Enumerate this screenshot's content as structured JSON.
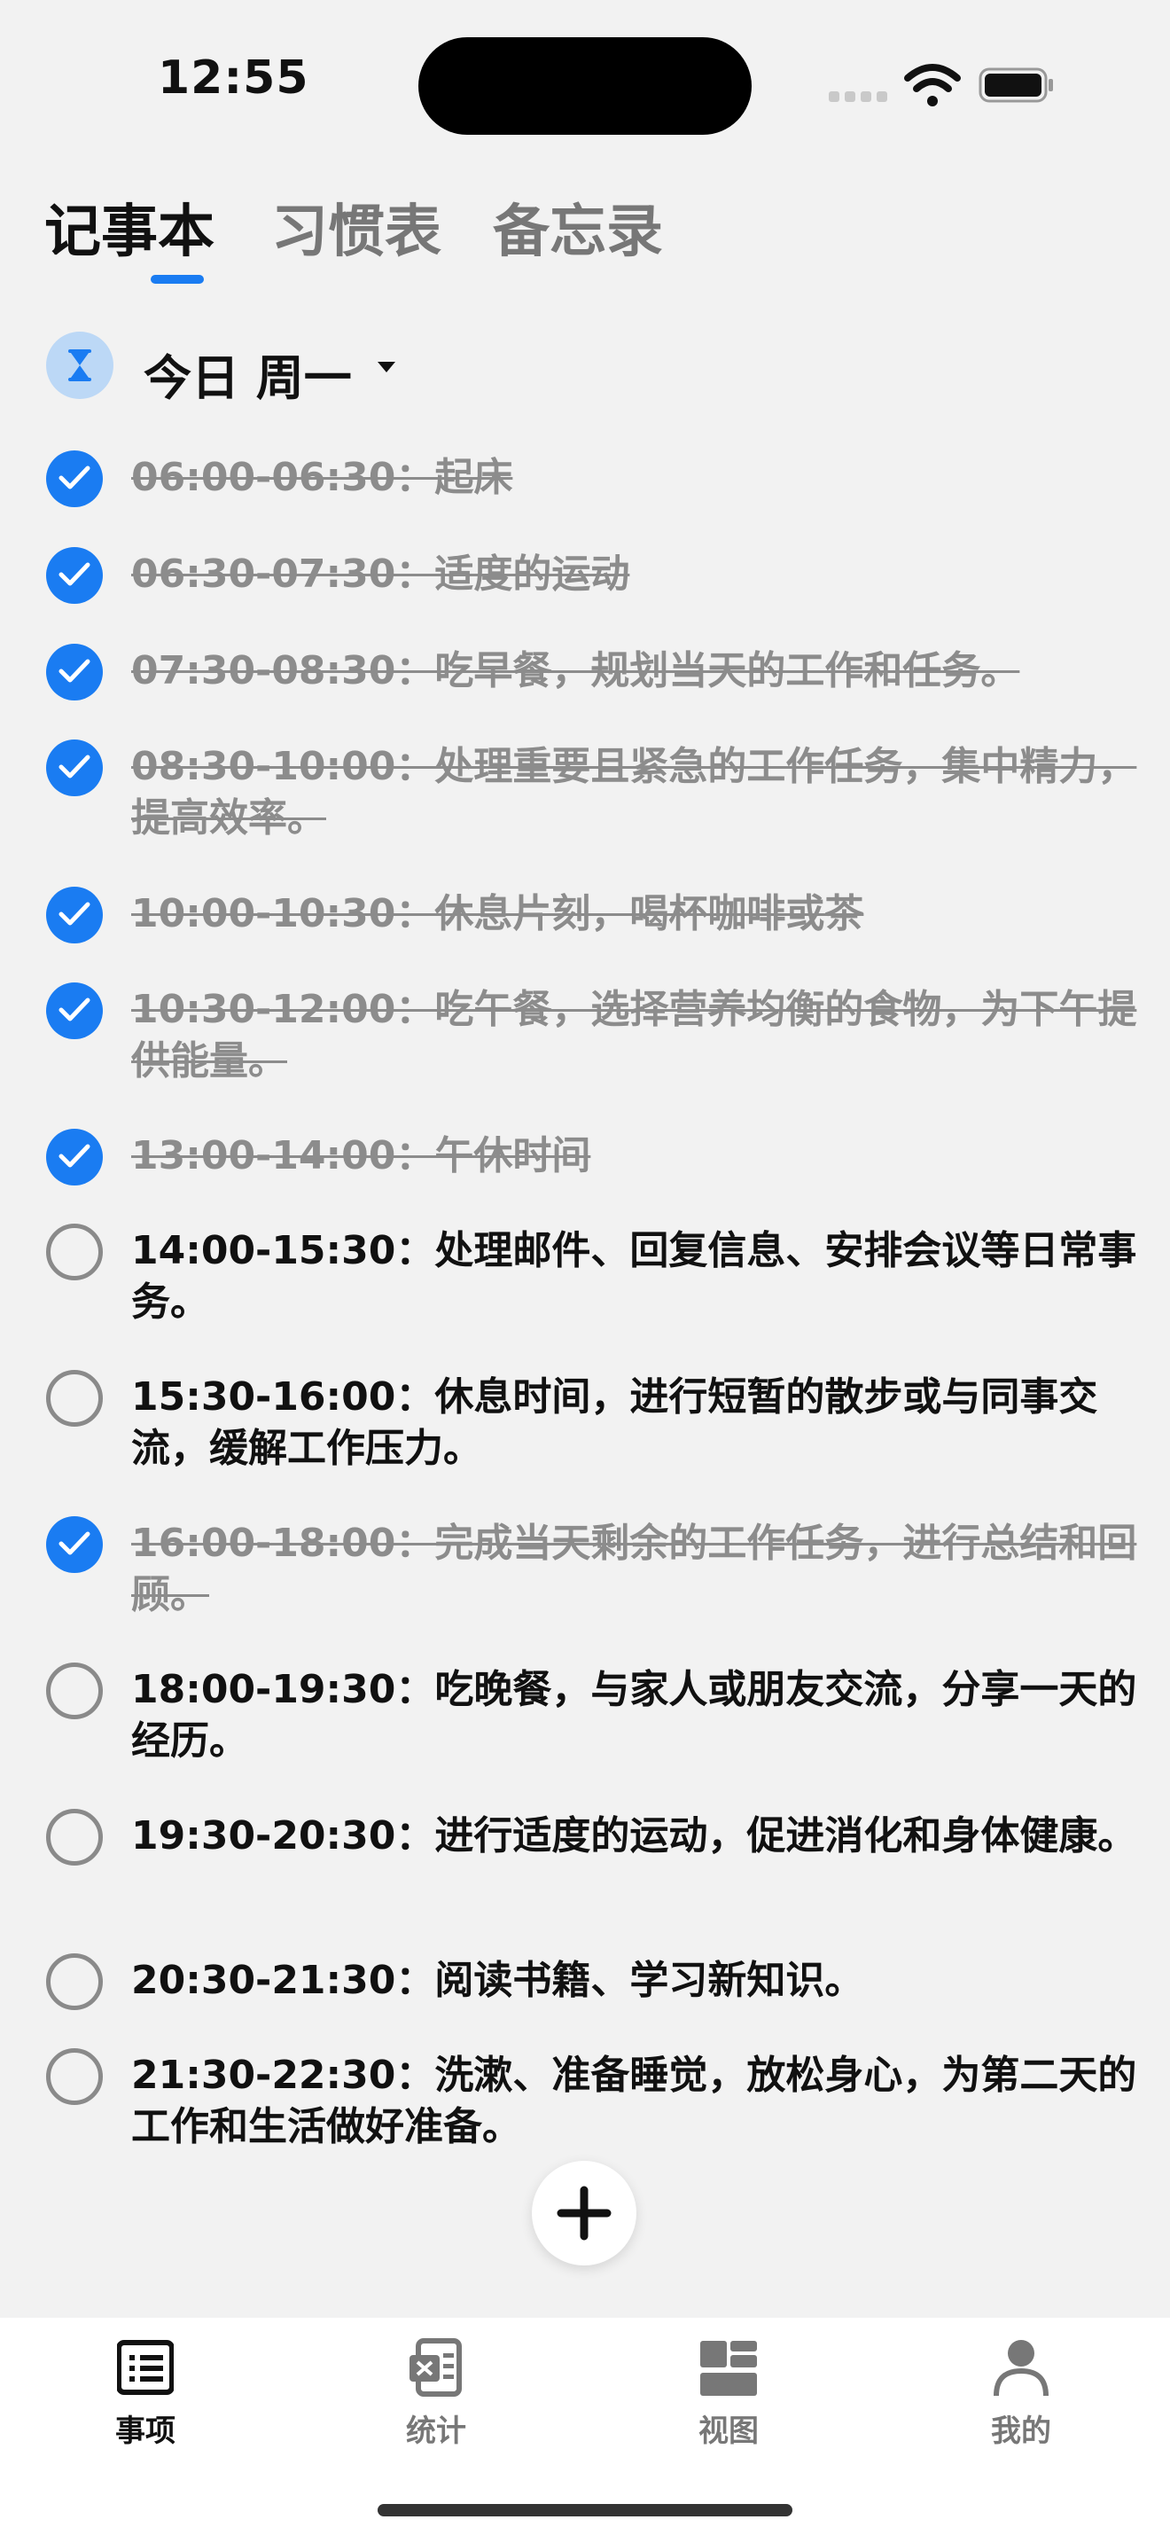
{
  "status_bar": {
    "time": "12:55"
  },
  "tabs": [
    {
      "label": "记事本",
      "active": true
    },
    {
      "label": "习惯表",
      "active": false
    },
    {
      "label": "备忘录",
      "active": false
    }
  ],
  "date_selector": {
    "label": "今日 周一",
    "icon": "hourglass-icon"
  },
  "tasks": [
    {
      "text": "06:00-06:30：起床",
      "done": true
    },
    {
      "text": "06:30-07:30：适度的运动",
      "done": true
    },
    {
      "text": "07:30-08:30：吃早餐，规划当天的工作和任务。",
      "done": true
    },
    {
      "text": "08:30-10:00：处理重要且紧急的工作任务，集中精力，提高效率。",
      "done": true
    },
    {
      "text": "10:00-10:30：休息片刻，喝杯咖啡或茶",
      "done": true
    },
    {
      "text": "10:30-12:00：吃午餐，选择营养均衡的食物，为下午提供能量。",
      "done": true
    },
    {
      "text": "13:00-14:00：午休时间",
      "done": true
    },
    {
      "text": "14:00-15:30：处理邮件、回复信息、安排会议等日常事务。",
      "done": false
    },
    {
      "text": "15:30-16:00：休息时间，进行短暂的散步或与同事交流，缓解工作压力。",
      "done": false
    },
    {
      "text": "16:00-18:00：完成当天剩余的工作任务，进行总结和回顾。",
      "done": true
    },
    {
      "text": "18:00-19:30：吃晚餐，与家人或朋友交流，分享一天的经历。",
      "done": false
    },
    {
      "text": "19:30-20:30：进行适度的运动，促进消化和身体健康。",
      "done": false
    },
    {
      "text": "20:30-21:30：阅读书籍、学习新知识。",
      "done": false
    },
    {
      "text": "21:30-22:30：洗漱、准备睡觉，放松身心，为第二天的工作和生活做好准备。",
      "done": false
    }
  ],
  "add_button": {
    "icon": "plus-icon"
  },
  "bottom_nav": [
    {
      "label": "事项",
      "icon": "list-icon",
      "active": true
    },
    {
      "label": "统计",
      "icon": "excel-icon",
      "active": false
    },
    {
      "label": "视图",
      "icon": "grid-view-icon",
      "active": false
    },
    {
      "label": "我的",
      "icon": "person-icon",
      "active": false
    }
  ],
  "colors": {
    "accent": "#1a7cf2",
    "done_text": "#8c8c8c",
    "background": "#f2f2f2"
  }
}
